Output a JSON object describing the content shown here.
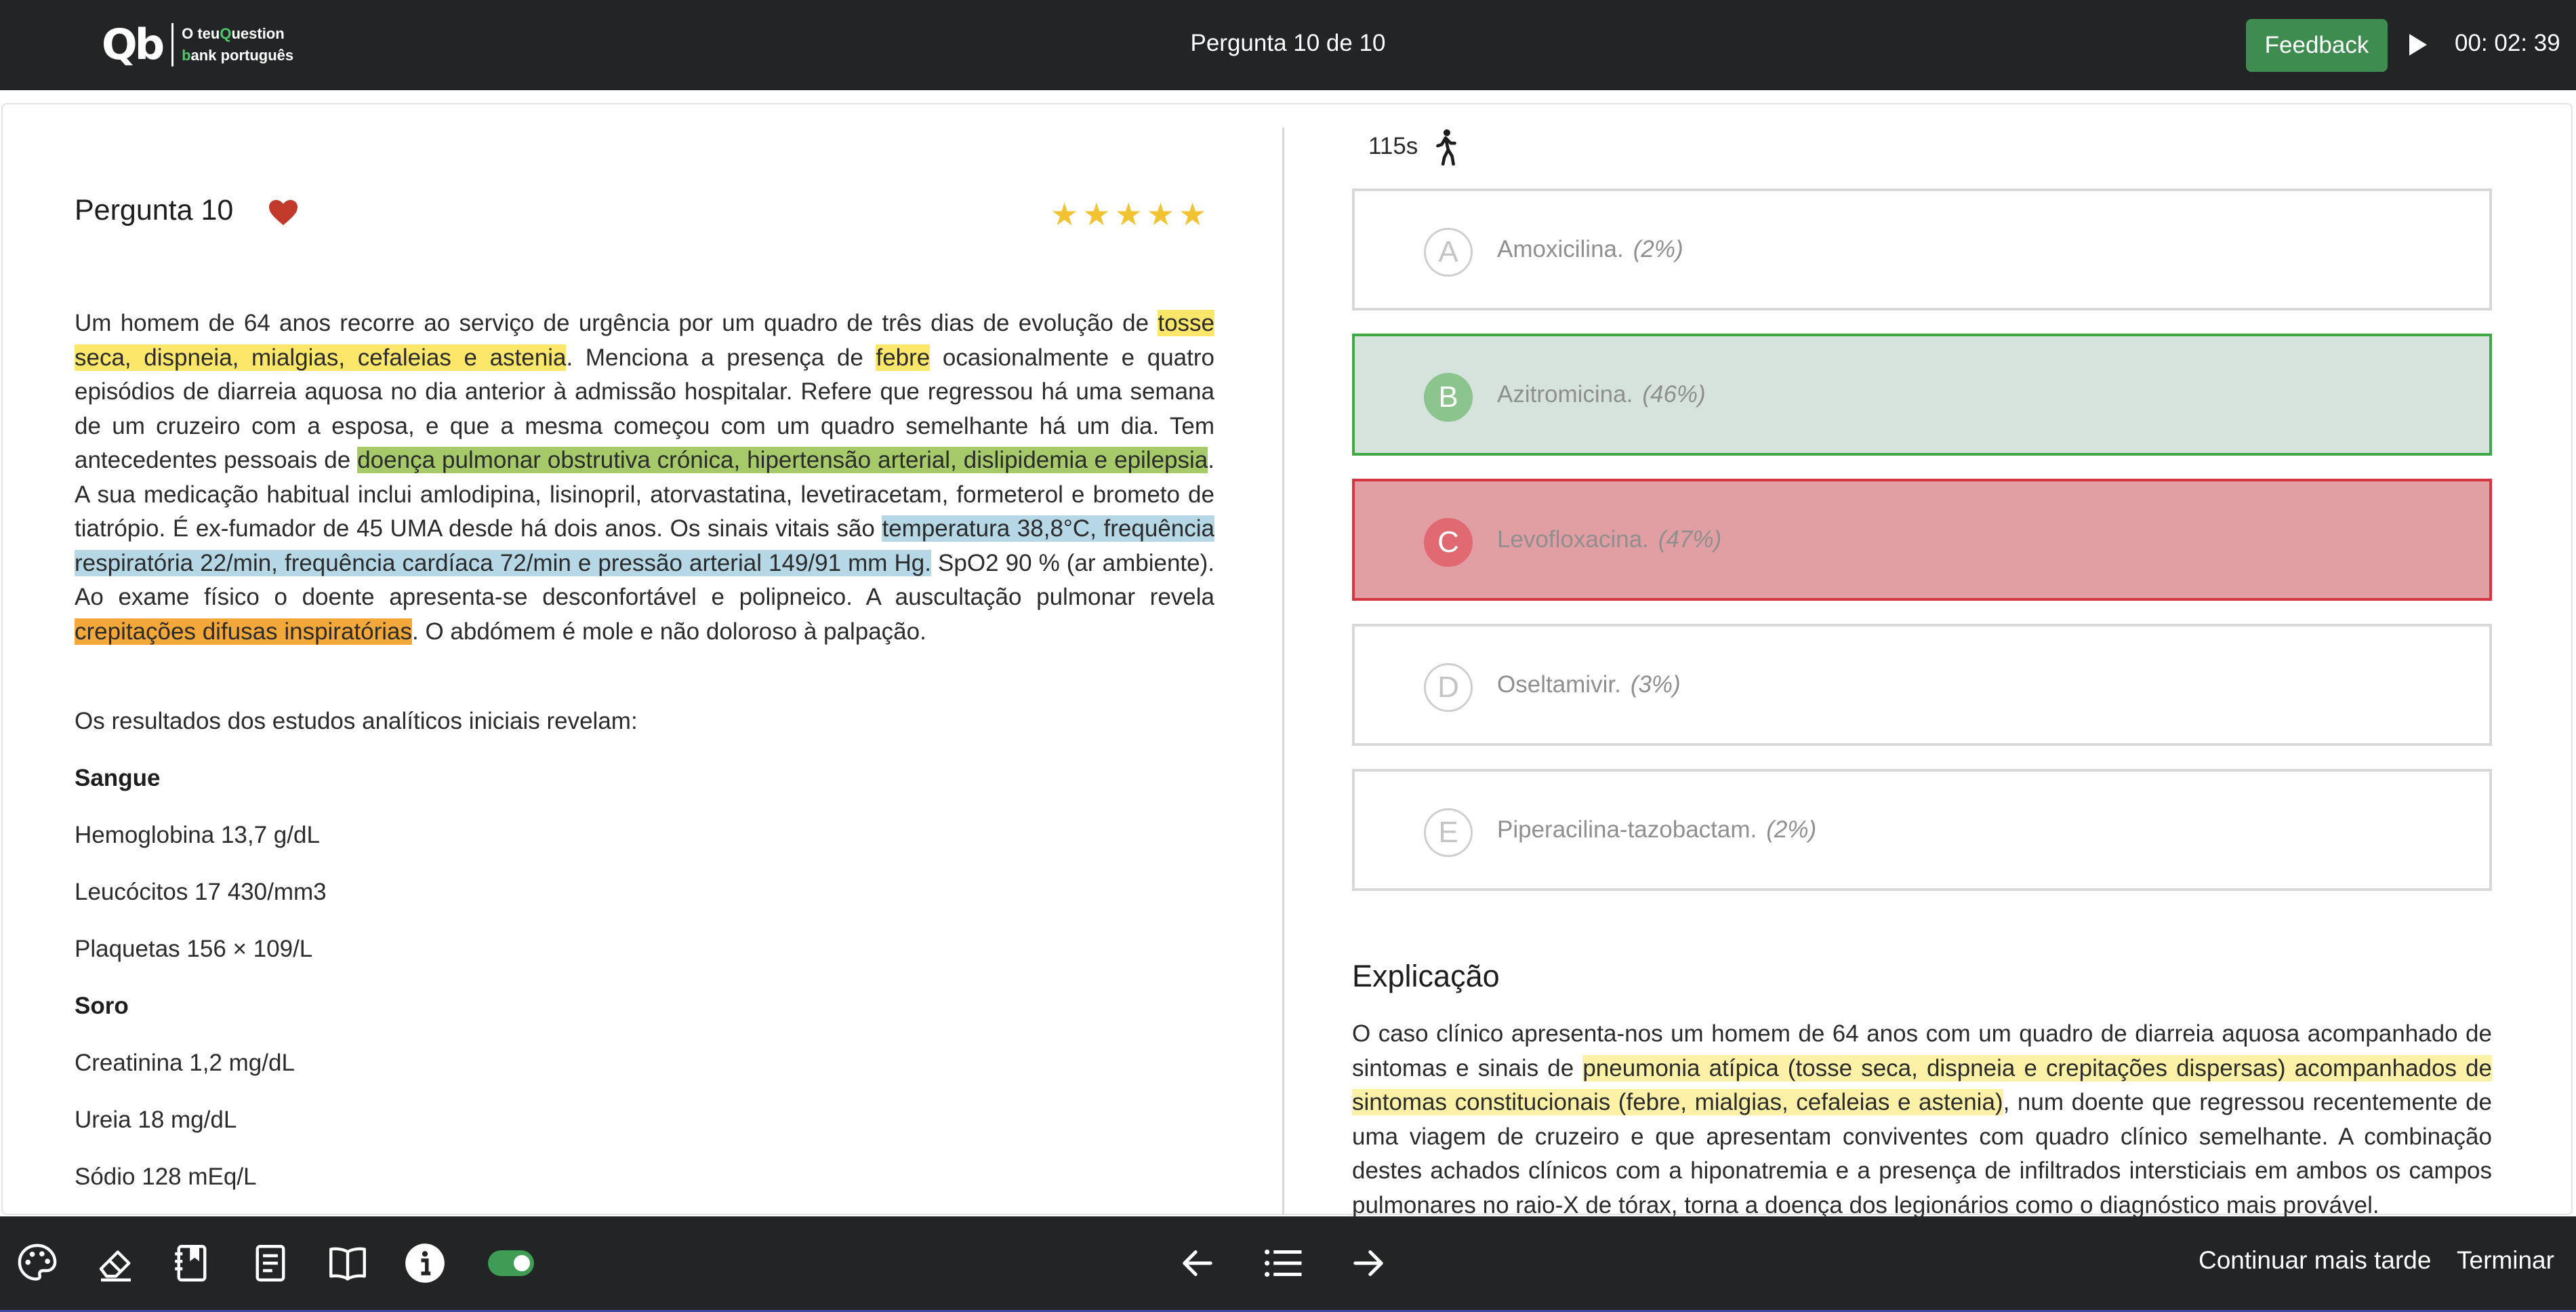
{
  "header": {
    "logo_mark": "Qb",
    "logo_line1_a": "O teu",
    "logo_line1_b": "Q",
    "logo_line1_c": "uestion",
    "logo_line2_a": "b",
    "logo_line2_b": "ank português",
    "title": "Pergunta 10 de 10",
    "feedback_label": "Feedback",
    "timer": "00: 02: 39"
  },
  "question": {
    "heading": "Pergunta 10",
    "rating_stars": 5,
    "stem": [
      {
        "t": "Um homem de 64 anos recorre ao serviço de urgência por um quadro de três dias de evolução de ",
        "h": ""
      },
      {
        "t": "tosse seca, dispneia, mialgias, cefaleias e astenia",
        "h": "y"
      },
      {
        "t": ". Menciona a presença de ",
        "h": ""
      },
      {
        "t": "febre",
        "h": "y"
      },
      {
        "t": " ocasionalmente e quatro episódios de diarreia aquosa no dia anterior à admissão hospitalar. Refere que regressou há uma semana de um cruzeiro com a esposa, e que a mesma começou com um quadro semelhante há um dia. Tem antecedentes pessoais de ",
        "h": ""
      },
      {
        "t": "doença pulmonar obstrutiva crónica, hipertensão arterial, dislipidemia e epilepsia",
        "h": "g"
      },
      {
        "t": ". A sua medicação habitual inclui amlodipina, lisinopril, atorvastatina, levetiracetam, formeterol e brometo de tiatrópio. É ex-fumador de 45 UMA desde há dois anos. Os sinais vitais são ",
        "h": ""
      },
      {
        "t": "temperatura 38,8°C, frequência respiratória 22/min, frequência cardíaca 72/min e pressão arterial 149/91 mm Hg.",
        "h": "b"
      },
      {
        "t": " SpO2 90 % (ar ambiente). Ao exame físico o doente apresenta-se desconfortável e polipneico. A auscultação pulmonar revela ",
        "h": ""
      },
      {
        "t": "crepitações difusas inspiratórias",
        "h": "o"
      },
      {
        "t": ". O abdómem é mole e não doloroso à palpação.",
        "h": ""
      }
    ],
    "intro_results": "Os resultados dos estudos analíticos iniciais revelam:",
    "section_blood": "Sangue",
    "hemoglobin": "Hemoglobina 13,7 g/dL",
    "leukocytes": "Leucócitos 17 430/mm3",
    "platelets": "Plaquetas 156 × 109/L",
    "section_serum": "Soro",
    "creatinine": "Creatinina 1,2 mg/dL",
    "urea": "Ureia 18 mg/dL",
    "sodium": "Sódio 128 mEq/L"
  },
  "answer_panel": {
    "time_used": "115s",
    "options": [
      {
        "letter": "A",
        "text": "Amoxicilina.",
        "pct": "(2%)",
        "state": "neutral"
      },
      {
        "letter": "B",
        "text": "Azitromicina.",
        "pct": "(46%)",
        "state": "correct"
      },
      {
        "letter": "C",
        "text": "Levofloxacina.",
        "pct": "(47%)",
        "state": "wrong"
      },
      {
        "letter": "D",
        "text": "Oseltamivir.",
        "pct": "(3%)",
        "state": "neutral"
      },
      {
        "letter": "E",
        "text": "Piperacilina-tazobactam.",
        "pct": "(2%)",
        "state": "neutral"
      }
    ],
    "explanation_title": "Explicação",
    "explanation": [
      {
        "t": "O caso clínico apresenta-nos um homem de 64 anos com um quadro de diarreia aquosa acompanhado de sintomas e sinais de ",
        "h": ""
      },
      {
        "t": "pneumonia atípica (tosse seca, dispneia e crepitações dispersas) acompanhados de sintomas constitucionais (febre, mialgias, cefaleias e astenia)",
        "h": "ly"
      },
      {
        "t": ", num doente que regressou recentemente de uma viagem de cruzeiro e que apresentam conviventes com quadro clínico semelhante. A combinação destes achados clínicos com a hiponatremia e a presença de infiltrados intersticiais em ambos os campos pulmonares no raio-X de tórax, torna a doença dos legionários como o diagnóstico mais provável.",
        "h": ""
      }
    ]
  },
  "footer": {
    "continue_later": "Continuar mais tarde",
    "finish": "Terminar"
  },
  "colors": {
    "bar_bg": "#222425",
    "feedback_green": "#3e8c4f",
    "correct_bg": "#d5e3dc",
    "correct_border": "#3ea845",
    "wrong_bg": "#e19ea3",
    "wrong_border": "#d6353f",
    "highlight_yellow": "#fde76a",
    "highlight_green": "#a6c96a",
    "highlight_blue": "#b6d7e6",
    "highlight_orange": "#f4a83a",
    "heart_red": "#c0392b",
    "star_gold": "#f1c232"
  }
}
